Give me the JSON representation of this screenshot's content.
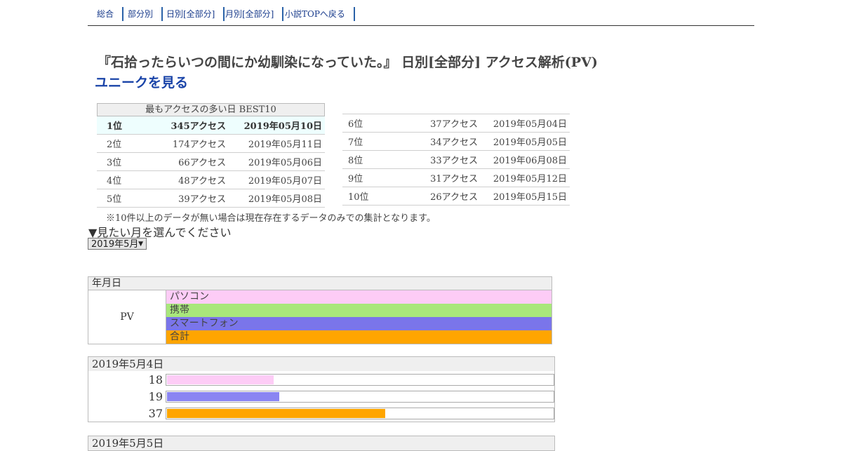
{
  "nav": {
    "tabs": [
      "総合",
      "部分別",
      "日別[全部分]",
      "月別[全部分]",
      "小説TOPへ戻る"
    ]
  },
  "title": "『石拾ったらいつの間にか幼馴染になっていた。』 日別[全部分] アクセス解析(PV)",
  "unique_link": "ユニークを見る",
  "best10": {
    "caption": "最もアクセスの多い日 BEST10",
    "rows": [
      {
        "rank": "1位",
        "count": "345アクセス",
        "date": "2019年05月10日"
      },
      {
        "rank": "2位",
        "count": "174アクセス",
        "date": "2019年05月11日"
      },
      {
        "rank": "3位",
        "count": "66アクセス",
        "date": "2019年05月06日"
      },
      {
        "rank": "4位",
        "count": "48アクセス",
        "date": "2019年05月07日"
      },
      {
        "rank": "5位",
        "count": "39アクセス",
        "date": "2019年05月08日"
      },
      {
        "rank": "6位",
        "count": "37アクセス",
        "date": "2019年05月04日"
      },
      {
        "rank": "7位",
        "count": "34アクセス",
        "date": "2019年05月05日"
      },
      {
        "rank": "8位",
        "count": "33アクセス",
        "date": "2019年06月08日"
      },
      {
        "rank": "9位",
        "count": "31アクセス",
        "date": "2019年05月12日"
      },
      {
        "rank": "10位",
        "count": "26アクセス",
        "date": "2019年05月15日"
      }
    ],
    "note": "※10件以上のデータが無い場合は現在存在するデータのみでの集計となります。"
  },
  "month_prompt": "▼見たい月を選んでください",
  "month_select": {
    "selected": "2019年5月"
  },
  "legend": {
    "header": "年月日",
    "pv_label": "PV",
    "items": [
      {
        "label": "パソコン",
        "color": "#fdccf6"
      },
      {
        "label": "携帯",
        "color": "#a9e77b"
      },
      {
        "label": "スマートフォン",
        "color": "#7a75ea"
      },
      {
        "label": "合計",
        "color": "#ffa500"
      }
    ]
  },
  "chart_data": {
    "type": "bar",
    "days": [
      {
        "date": "2019年5月4日",
        "bars": [
          {
            "series": "パソコン",
            "value": 18,
            "color": "#fdccf6"
          },
          {
            "series": "スマートフォン",
            "value": 19,
            "color": "#8a85f2"
          },
          {
            "series": "合計",
            "value": 37,
            "color": "#ffa500"
          }
        ]
      },
      {
        "date": "2019年5月5日",
        "bars": []
      }
    ],
    "scale_max": 345
  }
}
